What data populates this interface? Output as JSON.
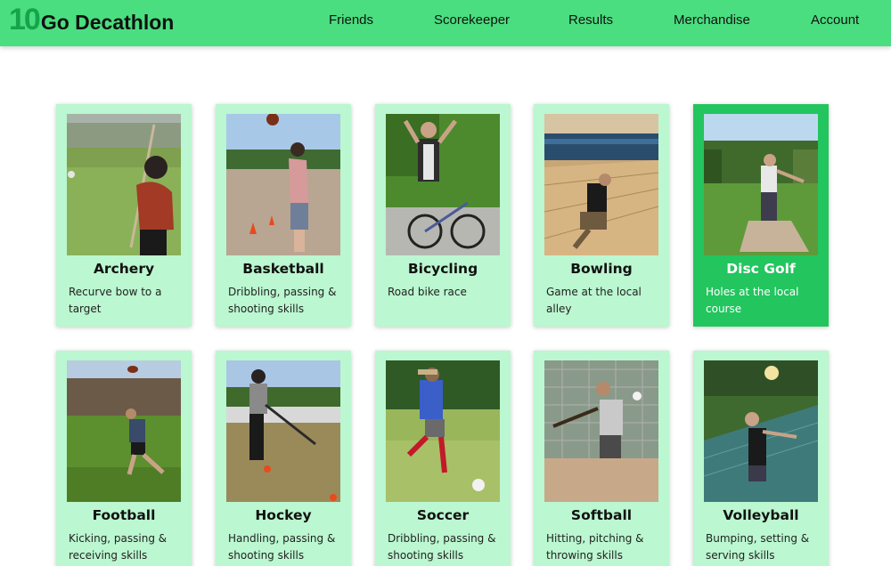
{
  "brand": {
    "number": "10",
    "name": "Go Decathlon"
  },
  "nav": {
    "friends": "Friends",
    "scorekeeper": "Scorekeeper",
    "results": "Results",
    "merchandise": "Merchandise",
    "account": "Account"
  },
  "colors": {
    "navbar": "#4ade80",
    "card": "#bbf7d0",
    "card_selected": "#22c55e",
    "brand_number": "#16a34a"
  },
  "selected_event": "Disc Golf",
  "events": [
    {
      "title": "Archery",
      "desc": "Recurve bow to a target"
    },
    {
      "title": "Basketball",
      "desc": "Dribbling, passing & shooting skills"
    },
    {
      "title": "Bicycling",
      "desc": "Road bike race"
    },
    {
      "title": "Bowling",
      "desc": "Game at the local alley"
    },
    {
      "title": "Disc Golf",
      "desc": "Holes at the local course"
    },
    {
      "title": "Football",
      "desc": "Kicking, passing & receiving skills"
    },
    {
      "title": "Hockey",
      "desc": "Handling, passing & shooting skills"
    },
    {
      "title": "Soccer",
      "desc": "Dribbling, passing & shooting skills"
    },
    {
      "title": "Softball",
      "desc": "Hitting, pitching & throwing skills"
    },
    {
      "title": "Volleyball",
      "desc": "Bumping, setting & serving skills"
    }
  ]
}
